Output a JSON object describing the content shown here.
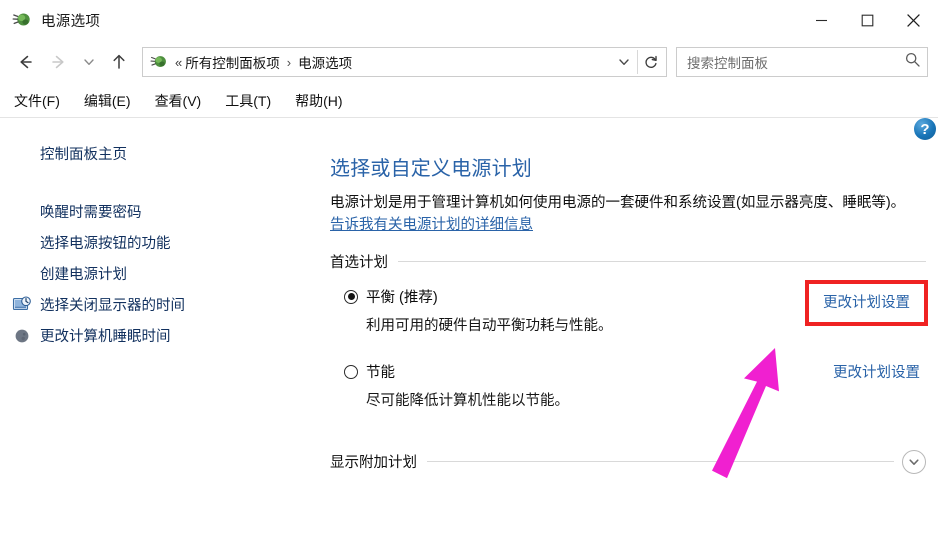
{
  "window": {
    "title": "电源选项",
    "title_icon": "power-plug-icon",
    "controls": {
      "minimize": "minimize-icon",
      "maximize": "maximize-icon",
      "close": "close-icon"
    }
  },
  "navbar": {
    "back": "back-arrow-icon",
    "forward": "forward-arrow-icon",
    "recent": "chevron-down-icon",
    "up": "up-arrow-icon",
    "address": {
      "icon": "power-plug-icon",
      "chevrons": "«",
      "crumbs": [
        "所有控制面板项",
        "电源选项"
      ],
      "separator": "›",
      "dropdown": "chevron-down-icon",
      "refresh": "refresh-icon"
    },
    "search": {
      "placeholder": "搜索控制面板",
      "icon": "search-icon"
    }
  },
  "menubar": {
    "items": [
      "文件(F)",
      "编辑(E)",
      "查看(V)",
      "工具(T)",
      "帮助(H)"
    ]
  },
  "sidebar": {
    "home": "控制面板主页",
    "items": [
      {
        "label": "唤醒时需要密码",
        "icon": null
      },
      {
        "label": "选择电源按钮的功能",
        "icon": null
      },
      {
        "label": "创建电源计划",
        "icon": null
      },
      {
        "label": "选择关闭显示器的时间",
        "icon": "monitor-clock-icon"
      },
      {
        "label": "更改计算机睡眠时间",
        "icon": "moon-icon"
      }
    ]
  },
  "main": {
    "help_label": "?",
    "help_icon": "help-question-icon",
    "title": "选择或自定义电源计划",
    "description_before": "电源计划是用于管理计算机如何使用电源的一套硬件和系统设置(如显示器亮度、睡眠等)。",
    "description_link": "告诉我有关电源计划的详细信息",
    "preferred_group": "首选计划",
    "plans": [
      {
        "name": "平衡 (推荐)",
        "description": "利用可用的硬件自动平衡功耗与性能。",
        "selected": true,
        "action": "更改计划设置",
        "highlighted": true
      },
      {
        "name": "节能",
        "description": "尽可能降低计算机性能以节能。",
        "selected": false,
        "action": "更改计划设置",
        "highlighted": false
      }
    ],
    "additional_group": "显示附加计划",
    "additional_expander": "chevron-down-circle-icon"
  },
  "annotations": {
    "highlight_color": "#ef2222",
    "arrow_color": "#f020d0",
    "arrow_name": "magenta-pointer-arrow"
  }
}
